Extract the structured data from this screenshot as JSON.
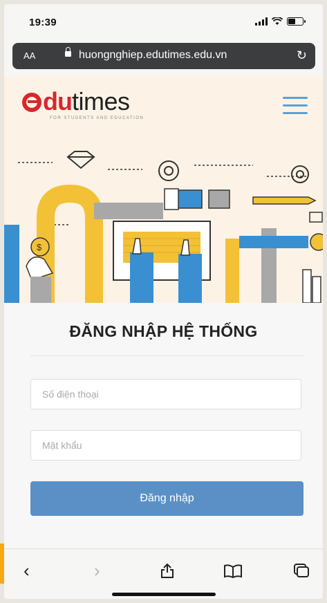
{
  "status_bar": {
    "time": "19:39"
  },
  "address_bar": {
    "text_size_label": "AA",
    "url": "huongnghiep.edutimes.edu.vn"
  },
  "site": {
    "logo": {
      "e": "e",
      "du": "du",
      "times": "times",
      "tagline": "FOR STUDENTS AND EDUCATION"
    },
    "brand_colors": {
      "red": "#d9262d",
      "blue": "#5aa0d8",
      "cream": "#fcf3e6"
    }
  },
  "login": {
    "title": "ĐĂNG NHẬP HỆ THỐNG",
    "phone_placeholder": "Số điện thoại",
    "password_placeholder": "Mật khẩu",
    "submit_label": "Đăng nhập",
    "button_color": "#5a90c6"
  },
  "toolbar": {
    "icons": [
      "back-icon",
      "forward-icon",
      "share-icon",
      "bookmarks-icon",
      "tabs-icon"
    ]
  }
}
